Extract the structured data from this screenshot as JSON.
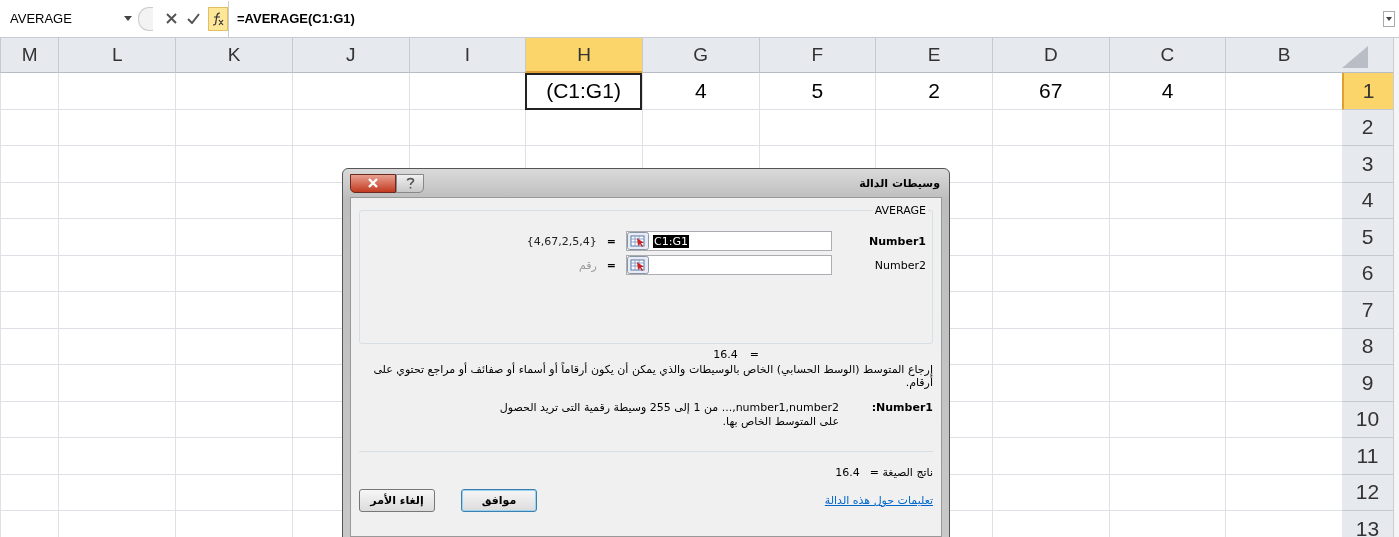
{
  "formula_bar": {
    "name_box": "AVERAGE",
    "formula": "=AVERAGE(C1:G1)"
  },
  "sheet": {
    "columns": [
      {
        "label": "B",
        "selected": false
      },
      {
        "label": "C",
        "selected": false,
        "row_1": "4"
      },
      {
        "label": "D",
        "selected": false,
        "row_1": "67"
      },
      {
        "label": "E",
        "selected": false,
        "row_1": "2"
      },
      {
        "label": "F",
        "selected": false,
        "row_1": "5"
      },
      {
        "label": "G",
        "selected": false,
        "row_1": "4"
      },
      {
        "label": "H",
        "selected": true,
        "row_1": "(C1:G1)"
      },
      {
        "label": "I",
        "selected": false
      },
      {
        "label": "J",
        "selected": false
      },
      {
        "label": "K",
        "selected": false
      },
      {
        "label": "L",
        "selected": false
      },
      {
        "label": "M",
        "selected": false
      }
    ],
    "rows": [
      {
        "label": "1",
        "selected": true
      },
      {
        "label": "2",
        "selected": false
      },
      {
        "label": "3",
        "selected": false
      },
      {
        "label": "4",
        "selected": false
      },
      {
        "label": "5",
        "selected": false
      },
      {
        "label": "6",
        "selected": false
      },
      {
        "label": "7",
        "selected": false
      },
      {
        "label": "8",
        "selected": false
      },
      {
        "label": "9",
        "selected": false
      },
      {
        "label": "10",
        "selected": false
      },
      {
        "label": "11",
        "selected": false
      },
      {
        "label": "12",
        "selected": false
      },
      {
        "label": "13",
        "selected": false
      }
    ]
  },
  "dialog": {
    "title": "وسيطات الدالة",
    "function_name": "AVERAGE",
    "arguments": [
      {
        "label": "Number1",
        "value": "C1:G1",
        "equals": "=",
        "result": "{4,67,2,5,4}",
        "selected": true
      },
      {
        "label": "Number2",
        "equals": "=",
        "result": "رقم",
        "selected": false
      }
    ],
    "preview": {
      "equals": "=",
      "value": "16.4"
    },
    "description": "إرجاع المتوسط (الوسط الحسابي) الخاص بالوسيطات والذي يمكن أن يكون أرقاماً أو أسماء أو صفائف أو مراجع تحتوي على أرقام.",
    "argument_help": {
      "label": "Number1:",
      "text": "number1,number2,... من 1 إلى 255 وسيطة رقمية التى تريد الحصول على المتوسط الخاص بها."
    },
    "formula_result": {
      "label": "ناتج الصيغة =",
      "value": "16.4"
    },
    "help_link": "تعليمات حول هذه الدالة",
    "buttons": [
      {
        "label": "موافق",
        "kind": "default"
      },
      {
        "label": "إلغاء الأمر",
        "kind": "normal"
      }
    ]
  }
}
